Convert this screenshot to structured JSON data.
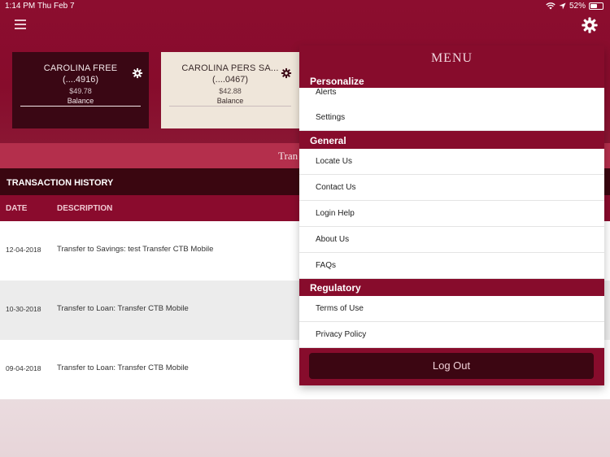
{
  "status_bar": {
    "time": "1:14 PM",
    "date": "Thu Feb 7",
    "battery": "52%"
  },
  "accounts": [
    {
      "name": "CAROLINA FREE",
      "number": "(....4916)",
      "amount": "$49.78",
      "label": "Balance"
    },
    {
      "name": "CAROLINA PERS SA...",
      "number": "(....0467)",
      "amount": "$42.88",
      "label": "Balance"
    }
  ],
  "transfer_strip": "Tran",
  "history": {
    "title": "TRANSACTION HISTORY",
    "columns": [
      "DATE",
      "DESCRIPTION"
    ],
    "rows": [
      {
        "date": "12-04-2018",
        "description": "Transfer to Savings: test Transfer CTB Mobile"
      },
      {
        "date": "10-30-2018",
        "description": "Transfer to Loan: Transfer CTB Mobile"
      },
      {
        "date": "09-04-2018",
        "description": "Transfer to Loan: Transfer CTB Mobile"
      }
    ]
  },
  "menu": {
    "title": "MENU",
    "sections": [
      {
        "header": "Personalize",
        "items": [
          "Alerts",
          "Settings"
        ]
      },
      {
        "header": "General",
        "items": [
          "Locate Us",
          "Contact Us",
          "Login Help",
          "About Us",
          "FAQs"
        ]
      },
      {
        "header": "Regulatory",
        "items": [
          "Terms of Use",
          "Privacy Policy"
        ]
      }
    ],
    "logout": "Log Out"
  },
  "colors": {
    "brand": "#870c2c",
    "dark": "#3a0610",
    "accent": "#b42f4c"
  },
  "icons": [
    "menu-icon",
    "gear-icon",
    "wifi-icon",
    "location-arrow-icon",
    "battery-icon"
  ]
}
